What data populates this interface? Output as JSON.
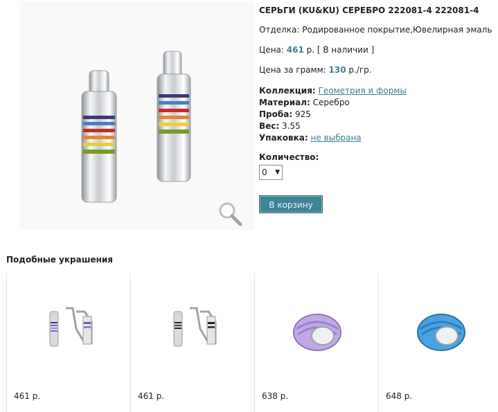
{
  "product": {
    "title": "СЕРЬГИ (KU&KU) СЕРЕБРО 222081-4 222081-4",
    "finish": "Отделка: Родированное покрытие,Ювелирная эмаль",
    "price_label": "Цена: ",
    "price_value": "461",
    "price_suffix": " р. [ В наличии ]",
    "ppg_label": "Цена за грамм: ",
    "ppg_value": "130",
    "ppg_suffix": " р./гр.",
    "attributes": [
      {
        "label": "Коллекция:",
        "value": "Геометрия и формы",
        "link": true
      },
      {
        "label": "Материал:",
        "value": "Серебро",
        "link": false
      },
      {
        "label": "Проба:",
        "value": "925",
        "link": false
      },
      {
        "label": "Вес:",
        "value": "3.55",
        "link": false
      },
      {
        "label": "Упаковка:",
        "value": "не выбрана",
        "link": true
      }
    ],
    "quantity_label": "Количество:",
    "quantity_value": "0",
    "cart_button": "В корзину",
    "zoom_icon": "magnifier-icon"
  },
  "similar": {
    "title": "Подобные украшения",
    "items": [
      {
        "price": "461 р.",
        "image": "earrings-rainbow"
      },
      {
        "price": "461 р.",
        "image": "earrings-black"
      },
      {
        "price": "638 р.",
        "image": "ring-lilac"
      },
      {
        "price": "648 р.",
        "image": "ring-blue"
      }
    ]
  },
  "colors": {
    "accent": "#3b7f8f",
    "button": "#3e8595"
  }
}
